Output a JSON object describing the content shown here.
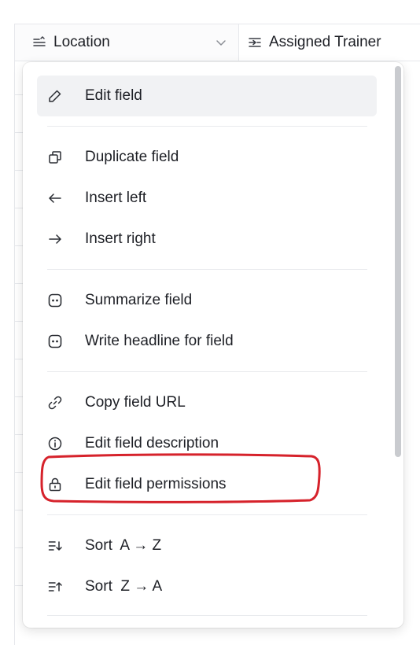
{
  "header": {
    "columns": [
      {
        "label": "Location",
        "icon": "long-text-icon",
        "dropdown": true
      },
      {
        "label": "Assigned Trainer",
        "icon": "linked-record-icon"
      }
    ]
  },
  "menu": {
    "groups": [
      [
        {
          "label": "Edit field",
          "icon": "pencil-icon",
          "highlighted": true
        }
      ],
      [
        {
          "label": "Duplicate field",
          "icon": "duplicate-icon"
        },
        {
          "label": "Insert left",
          "icon": "arrow-left-icon"
        },
        {
          "label": "Insert right",
          "icon": "arrow-right-icon"
        }
      ],
      [
        {
          "label": "Summarize field",
          "icon": "ai-icon"
        },
        {
          "label": "Write headline for field",
          "icon": "ai-icon"
        }
      ],
      [
        {
          "label": "Copy field URL",
          "icon": "link-icon"
        },
        {
          "label": "Edit field description",
          "icon": "info-icon"
        },
        {
          "label": "Edit field permissions",
          "icon": "lock-icon",
          "annotated": true
        }
      ],
      [
        {
          "label": "Sort  A → Z",
          "icon": "sort-ascending-icon"
        },
        {
          "label": "Sort  Z → A",
          "icon": "sort-descending-icon"
        }
      ]
    ]
  },
  "colors": {
    "annotation": "#d6222b",
    "highlight": "#f1f2f4",
    "text": "#1d1f25",
    "scrollbar": "#c9cbcf"
  }
}
